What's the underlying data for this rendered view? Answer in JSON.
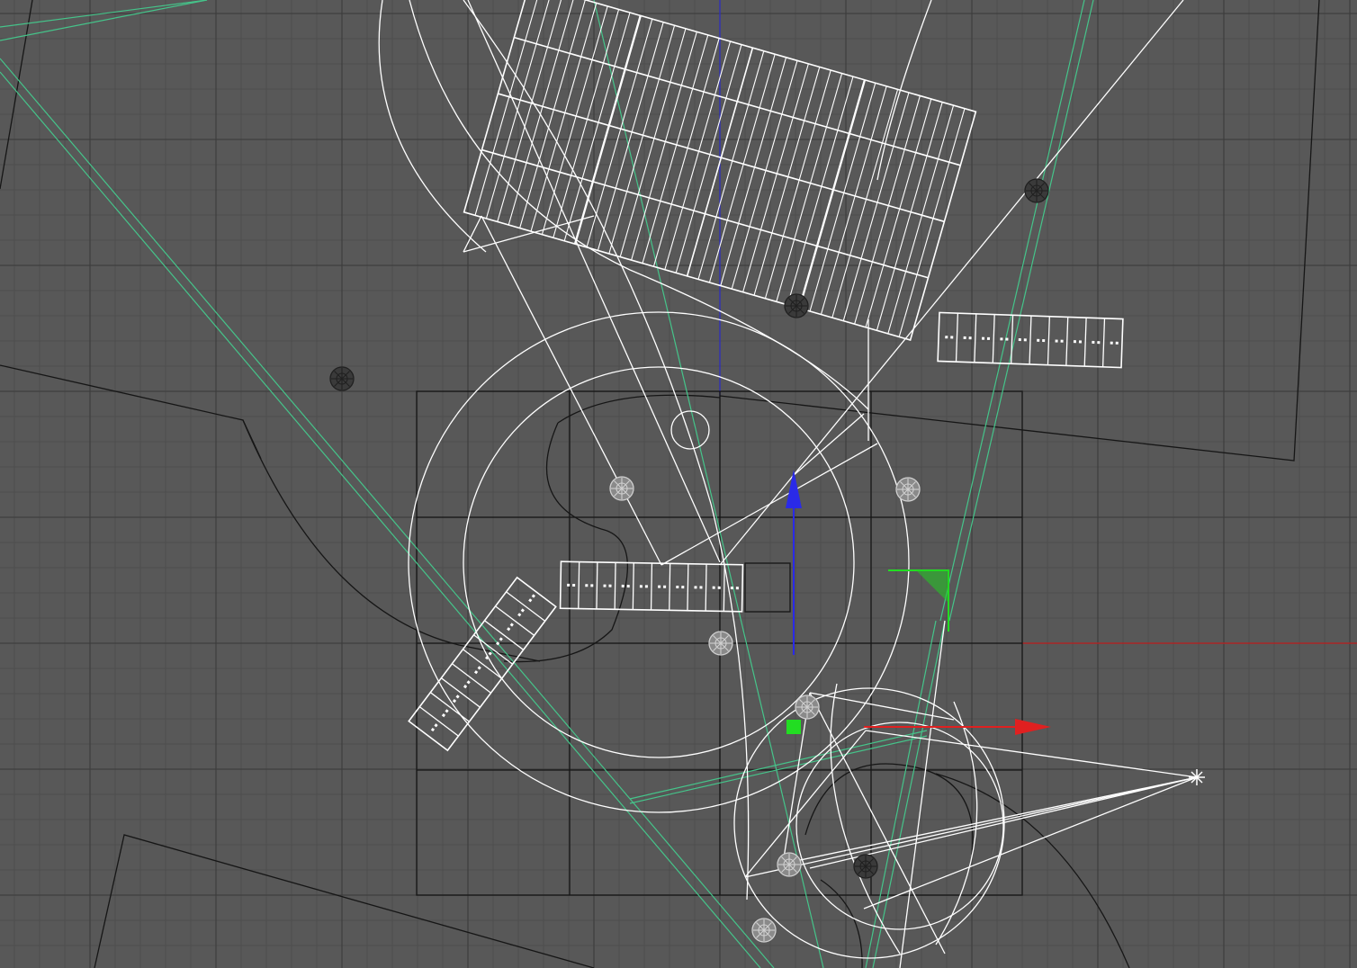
{
  "viewport": {
    "view": "top",
    "background": "#585858",
    "grid_minor_color": "#4e4e4e",
    "grid_major_color": "#3e3e3e"
  },
  "colors": {
    "wireframe": "#ffffff",
    "object_outline": "#161616",
    "light_guide": "#45c48a",
    "axis_x": "#e02020",
    "axis_y": "#2020e0",
    "rotate_gizmo": "#20d020",
    "world_axis_x": "#c02020",
    "world_axis_y": "#3030c0"
  },
  "icons": {
    "transform_gizmo": "move-gizmo-icon",
    "light": "light-icon",
    "camera": "camera-icon"
  }
}
